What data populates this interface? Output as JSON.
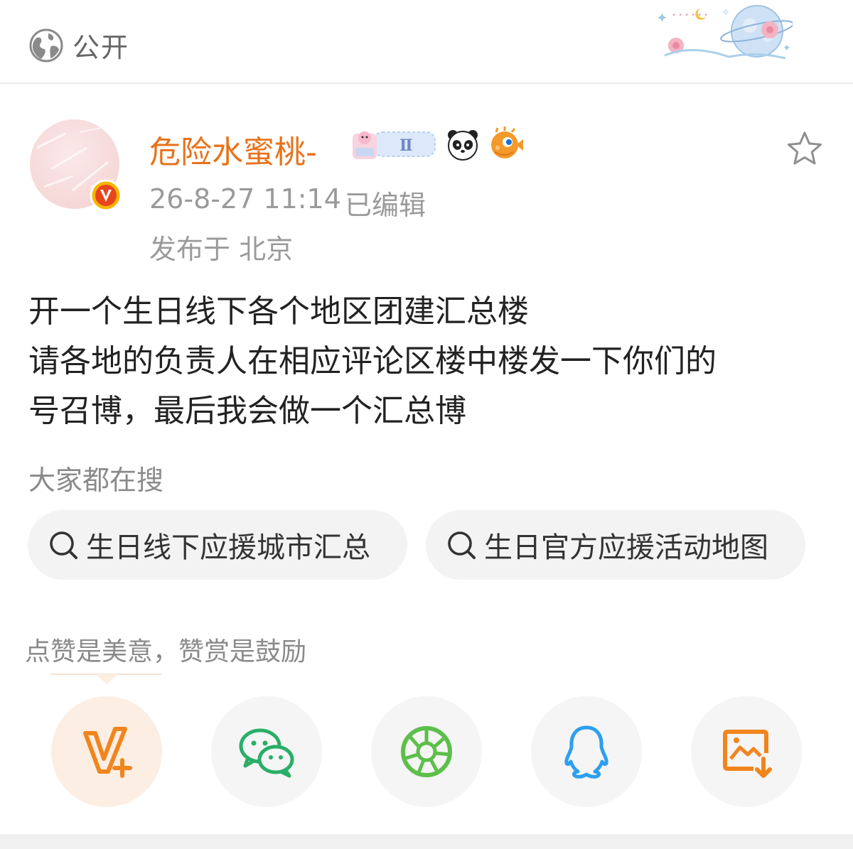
{
  "topbar": {
    "visibility_label": "公开",
    "visibility_icon": "globe-icon"
  },
  "author": {
    "name": "危险水蜜桃-",
    "badges": [
      "fan-badge-icon",
      "panda-icon",
      "pufferfish-icon"
    ],
    "fan_badge_text": "Ⅱ",
    "verified": true
  },
  "meta": {
    "time": "26-8-27 11:14",
    "edited": "已编辑",
    "location": "发布于 北京"
  },
  "post": {
    "lines": [
      "开一个生日线下各个地区团建汇总楼",
      "请各地的负责人在相应评论区楼中楼发一下你们的",
      "号召博，最后我会做一个汇总博"
    ]
  },
  "hot_search": {
    "label": "大家都在搜",
    "items": [
      "生日线下应援城市汇总",
      "生日官方应援活动地图"
    ]
  },
  "reward": {
    "tip": "点赞是美意，赞赏是鼓励"
  },
  "share": {
    "buttons": [
      "v-plus-icon",
      "wechat-icon",
      "moments-icon",
      "qq-icon",
      "save-image-icon"
    ]
  },
  "colors": {
    "username": "#e8721b",
    "accent": "#f0851e",
    "wechat": "#2aae67",
    "moments": "#5cbf4a",
    "qq": "#2d9ff0"
  }
}
